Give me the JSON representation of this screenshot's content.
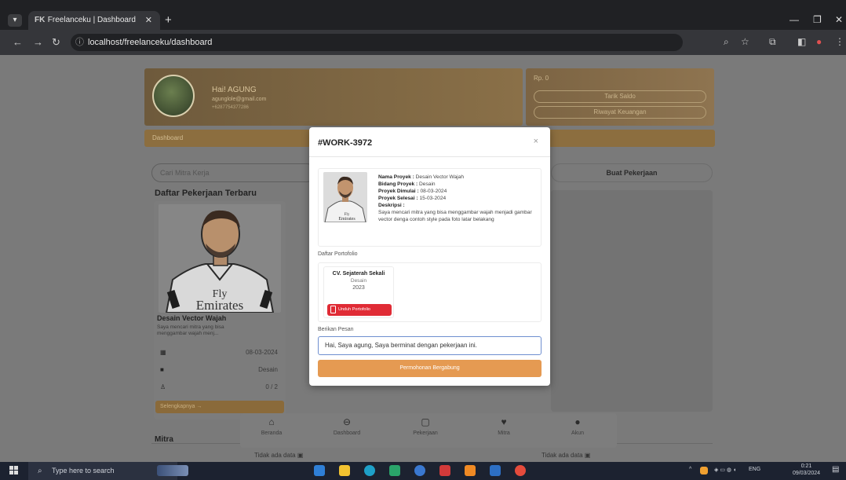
{
  "browser": {
    "tab_title": "Freelanceku | Dashboard",
    "tab_favicon": "FK",
    "url": "localhost/freelanceku/dashboard"
  },
  "profile": {
    "greeting": "Hai! AGUNG",
    "email": "agunglole@gmail.com",
    "phone": "+6287754377286"
  },
  "finance": {
    "balance": "Rp. 0",
    "withdraw_label": "Tarik Saldo",
    "history_label": "Riwayat Keuangan"
  },
  "dashboard_label": "Dashboard",
  "search_placeholder": "Cari Mitra Kerja",
  "create_job_label": "Buat Pekerjaan",
  "latest_jobs_title": "Daftar Pekerjaan Terbaru",
  "job_card": {
    "shirt_text_1": "Fly",
    "shirt_text_2": "Emirates",
    "title": "Desain Vector Wajah",
    "desc": "Saya mencari mitra yang bisa menggambar wajah menj...",
    "date": "08-03-2024",
    "category": "Desain",
    "slots": "0 / 2",
    "more_label": "Selengkapnya"
  },
  "mitra_title": "Mitra",
  "no_data_label": "Tidak ada data",
  "bottom_nav": [
    "Beranda",
    "Dashboard",
    "Pekerjaan",
    "Mitra",
    "Akun"
  ],
  "modal": {
    "title": "#WORK-3972",
    "close": "×",
    "photo_text_1": "Fly",
    "photo_text_2": "Emirates",
    "project_name_label": "Nama Proyek :",
    "project_name": "Desain Vector Wajah",
    "field_label": "Bidang Proyek :",
    "field": "Desain",
    "start_label": "Proyek Dimulai :",
    "start": "08-03-2024",
    "end_label": "Proyek Selesai :",
    "end": "15-03-2024",
    "desc_label": "Deskripsi :",
    "desc": "Saya mencari mitra yang bisa menggambar wajah menjadi gambar vector denga contoh style pada foto latar belakang",
    "portfolio_label": "Daftar Portofolio",
    "portfolio": {
      "name": "CV. Sejaterah Sekali",
      "field": "Desain",
      "year": "2023",
      "download_label": "Unduh Portofolio"
    },
    "message_label": "Berikan Pesan",
    "message_value": "Hai, Saya agung, Saya berminat dengan pekerjaan ini.",
    "submit_label": "Permohonan Bergabung"
  },
  "taskbar": {
    "search_placeholder": "Type here to search",
    "lang": "ENG",
    "time": "0:21",
    "date": "09/03/2024"
  }
}
